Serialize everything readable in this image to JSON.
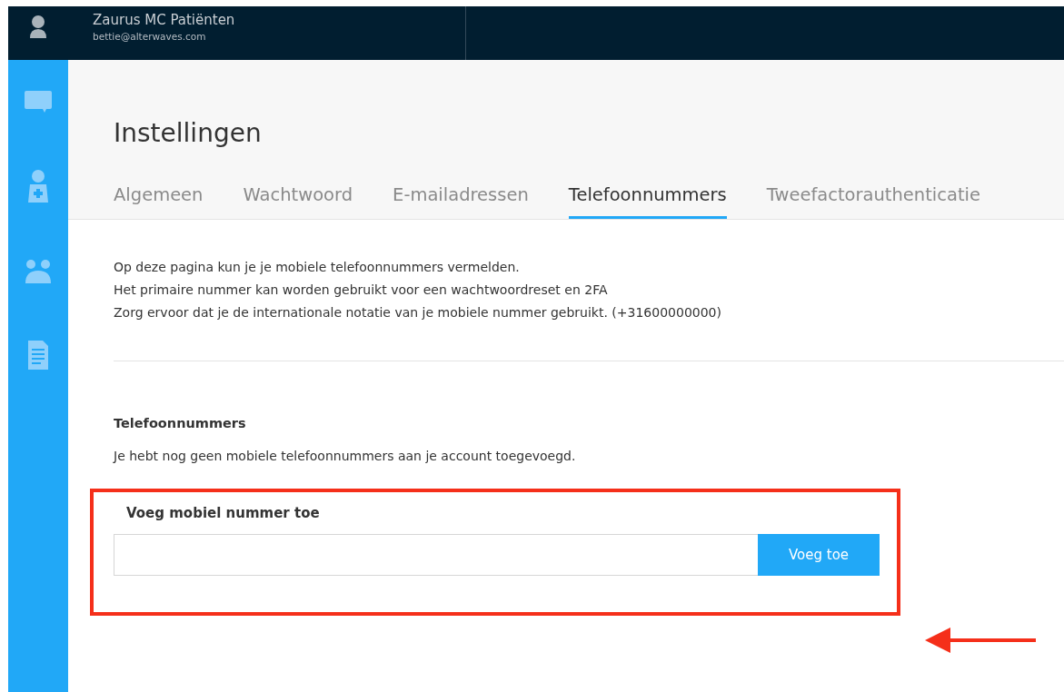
{
  "header": {
    "title": "Zaurus MC Patiënten",
    "email": "bettie@alterwaves.com"
  },
  "page_title": "Instellingen",
  "tabs": [
    {
      "label": "Algemeen",
      "selected": false
    },
    {
      "label": "Wachtwoord",
      "selected": false
    },
    {
      "label": "E-mailadressen",
      "selected": false
    },
    {
      "label": "Telefoonnummers",
      "selected": true
    },
    {
      "label": "Tweefactorauthenticatie",
      "selected": false
    }
  ],
  "intro": [
    "Op deze pagina kun je je mobiele telefoonnummers vermelden.",
    "Het primaire nummer kan worden gebruikt voor een wachtwoordreset en 2FA",
    "Zorg ervoor dat je de internationale notatie van je mobiele nummer gebruikt. (+31600000000)"
  ],
  "section": {
    "title": "Telefoonnummers",
    "empty_text": "Je hebt nog geen mobiele telefoonnummers aan je account toegevoegd."
  },
  "add_form": {
    "label": "Voeg mobiel nummer toe",
    "button": "Voeg toe"
  }
}
